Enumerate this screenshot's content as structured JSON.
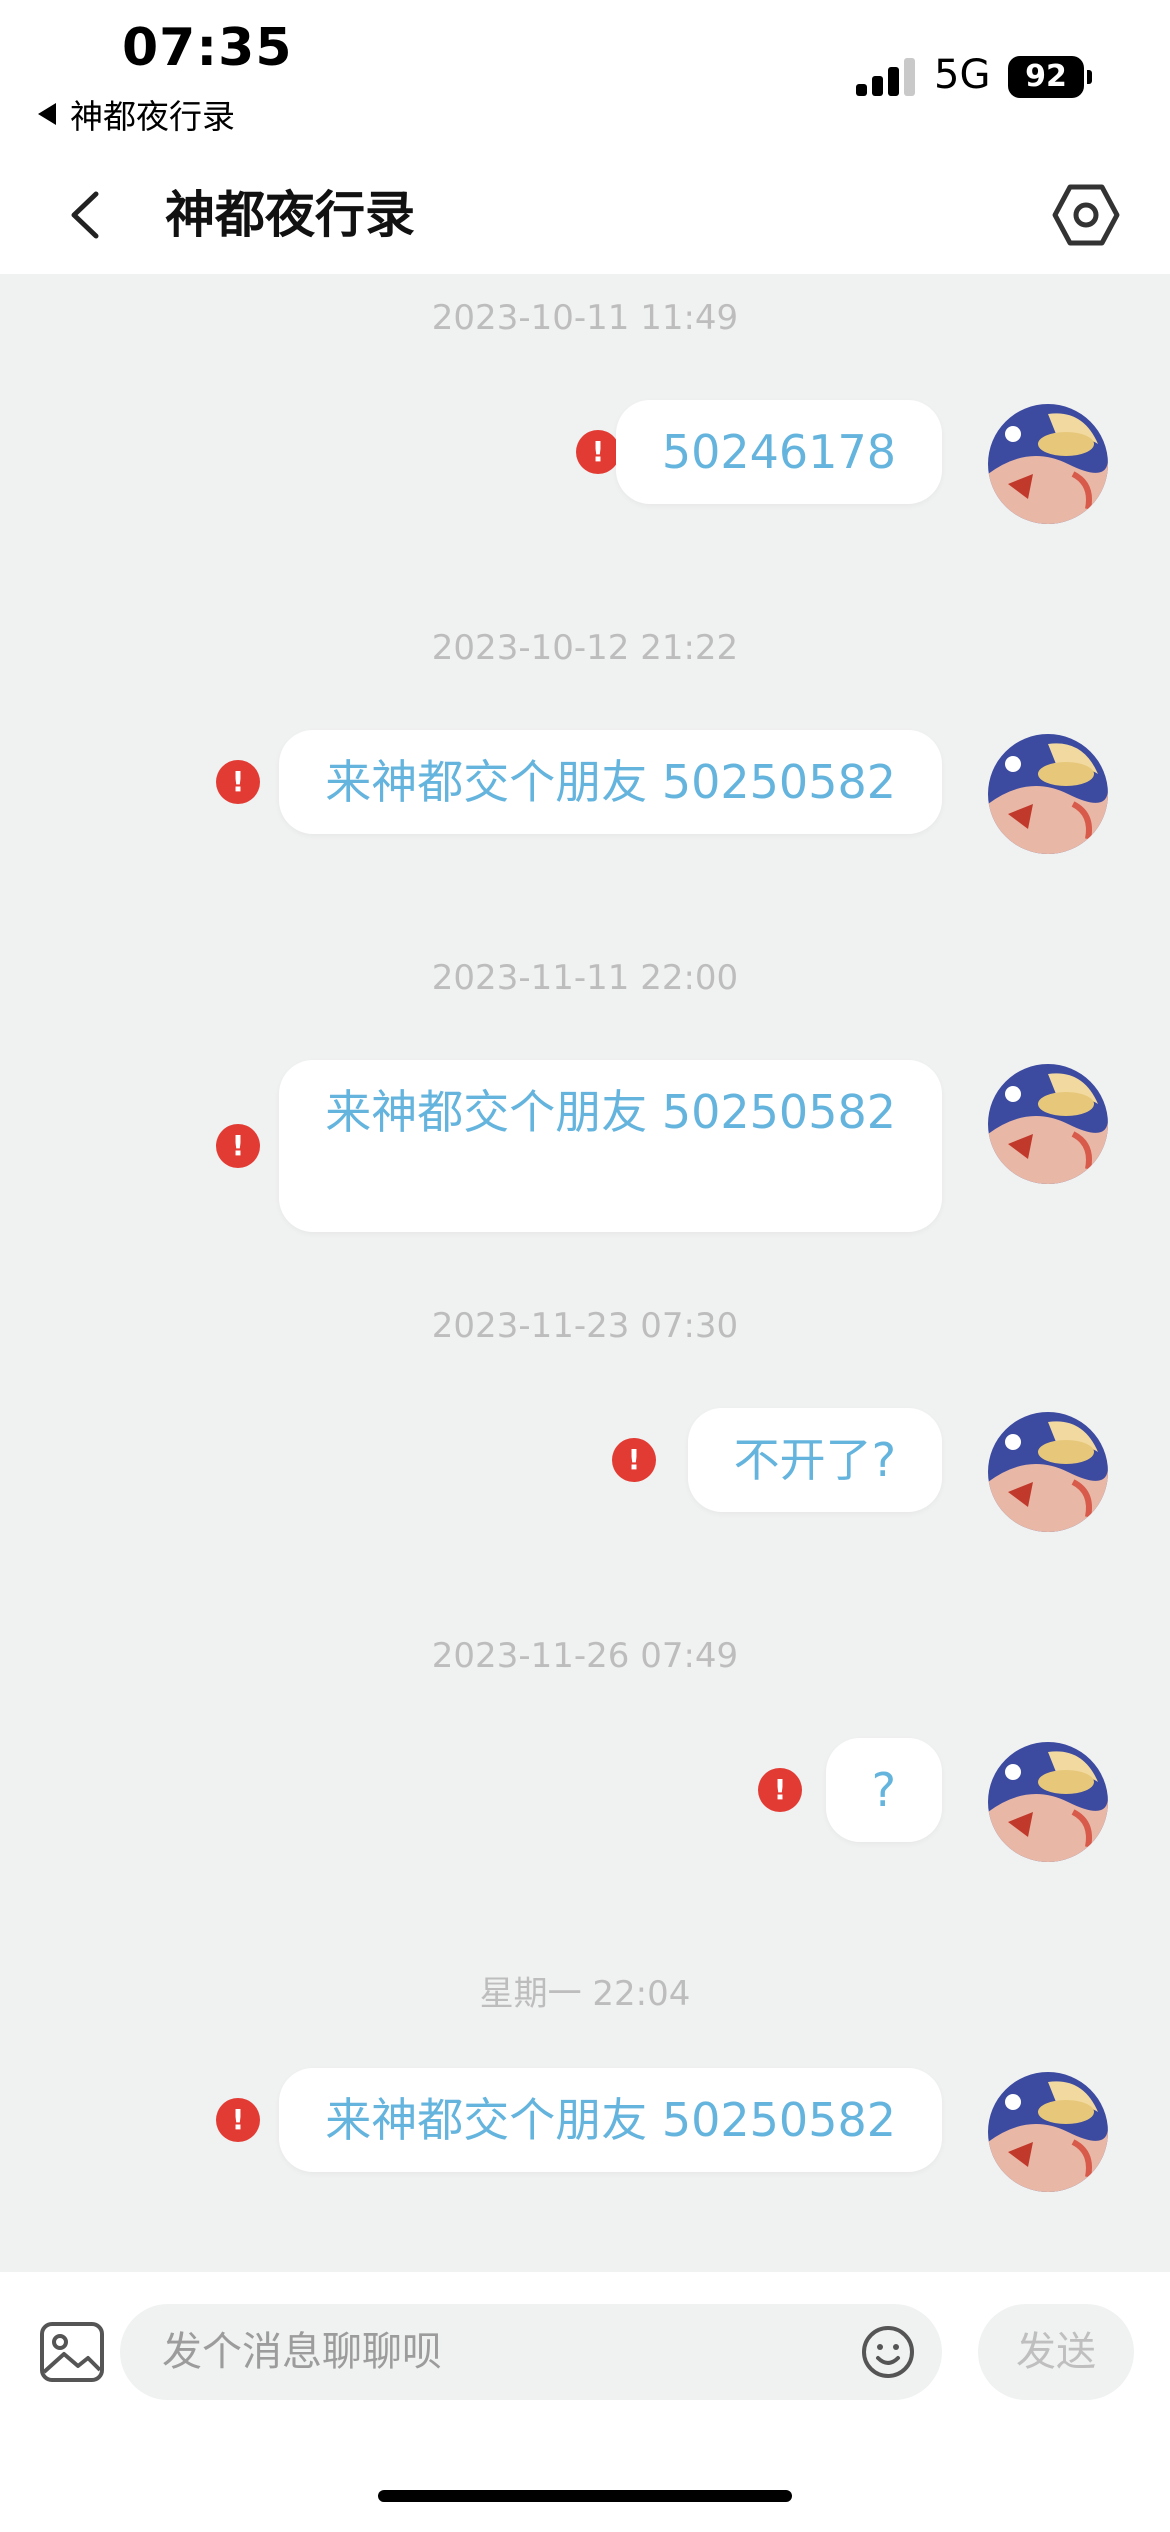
{
  "status_bar": {
    "time": "07:35",
    "back_app": "神都夜行录",
    "network": "5G",
    "battery": "92"
  },
  "header": {
    "title": "神都夜行录"
  },
  "messages": [
    {
      "timestamp": "2023-10-11 11:49",
      "text": "50246178",
      "status": "!"
    },
    {
      "timestamp": "2023-10-12 21:22",
      "text": "来神都交个朋友 50250582",
      "status": "!"
    },
    {
      "timestamp": "2023-11-11 22:00",
      "text": "来神都交个朋友 50250582",
      "status": "!"
    },
    {
      "timestamp": "2023-11-23 07:30",
      "text": "不开了?",
      "status": "!"
    },
    {
      "timestamp": "2023-11-26 07:49",
      "text": "?",
      "status": "!"
    },
    {
      "timestamp": "星期一 22:04",
      "text": "来神都交个朋友 50250582",
      "status": "!"
    }
  ],
  "input": {
    "placeholder": "发个消息聊聊呗",
    "send_label": "发送"
  },
  "icons": {
    "back": "chevron-left-icon",
    "settings": "hexagon-settings-icon",
    "image": "image-icon",
    "emoji": "smiley-icon",
    "error": "exclamation-icon"
  },
  "colors": {
    "bubble_text": "#64b4de",
    "error_badge": "#e23b34",
    "chat_background": "#f0f1f1"
  }
}
